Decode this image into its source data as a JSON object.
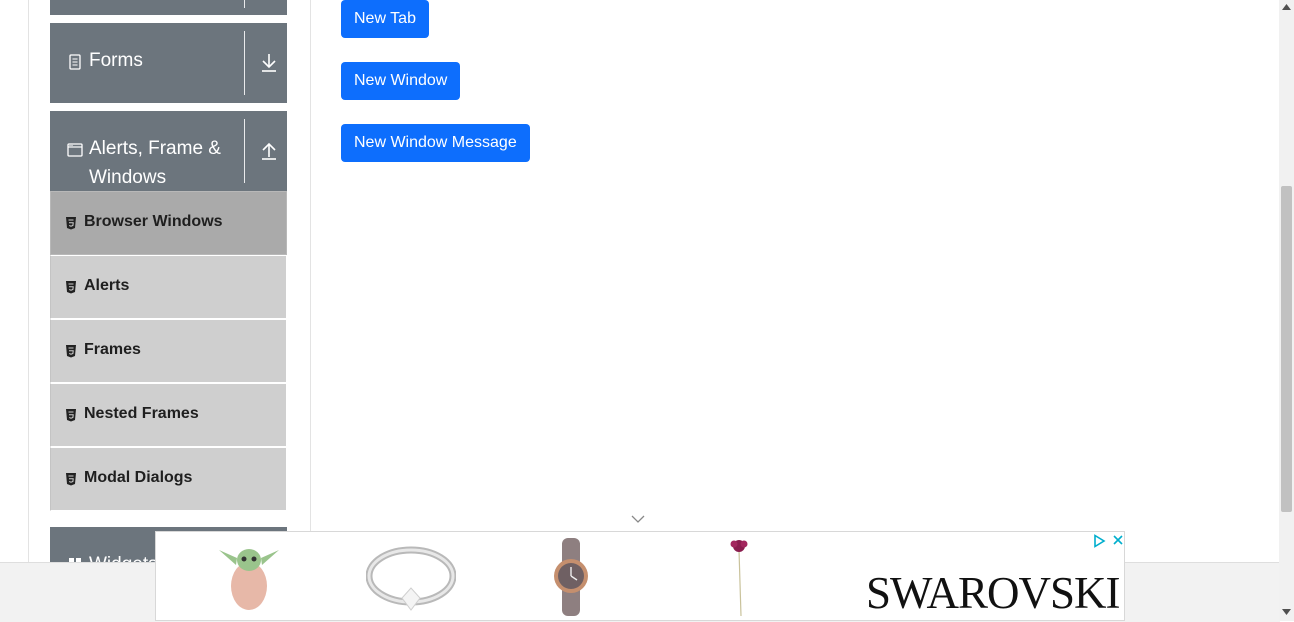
{
  "sidebar": {
    "groups": [
      {
        "label": "Forms",
        "icon": "document-icon",
        "toggle": "download-arrow-icon"
      },
      {
        "label": "Alerts, Frame &",
        "label2": "Windows",
        "icon": "window-icon",
        "toggle": "upload-arrow-icon"
      },
      {
        "label": "Widgets",
        "icon": "widgets-icon"
      }
    ],
    "items": [
      {
        "label": "Browser Windows",
        "active": true
      },
      {
        "label": "Alerts"
      },
      {
        "label": "Frames"
      },
      {
        "label": "Nested Frames"
      },
      {
        "label": "Modal Dialogs"
      }
    ]
  },
  "main": {
    "buttons": [
      {
        "label": "New Tab"
      },
      {
        "label": "New Window"
      },
      {
        "label": "New Window Message"
      }
    ]
  },
  "ad": {
    "brand": "SWAROVSKI",
    "products": [
      "figurine-image",
      "ring-image",
      "watch-image",
      "flower-image"
    ]
  },
  "colors": {
    "sidebar_group_bg": "#6c757d",
    "sidebar_item_bg": "#cfcfcf",
    "sidebar_item_active_bg": "#aaaaaa",
    "button_bg": "#0d6efd"
  }
}
